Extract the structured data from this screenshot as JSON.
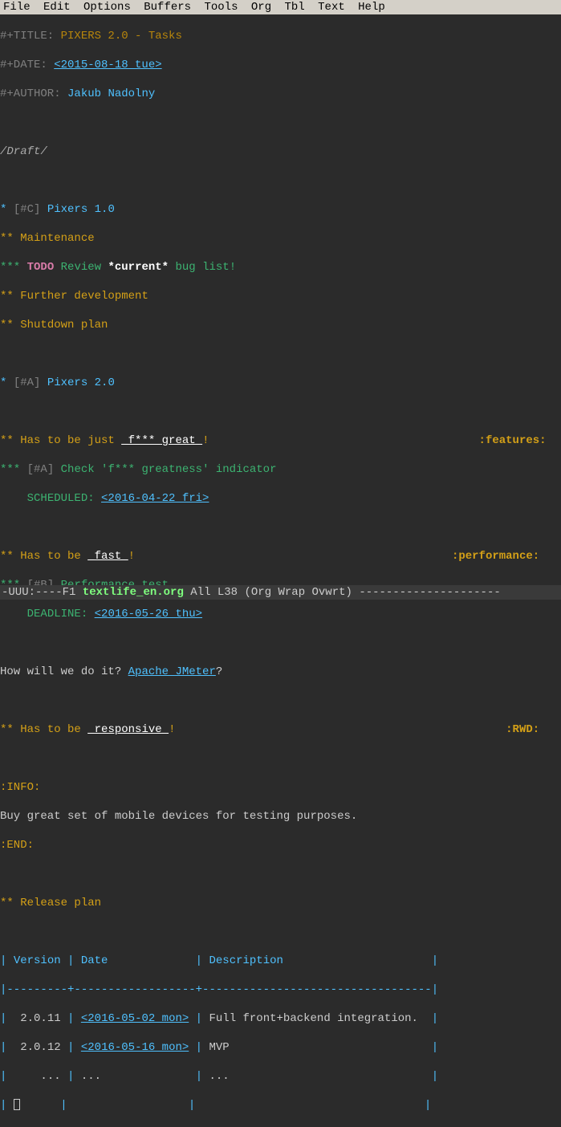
{
  "menubar": {
    "items": [
      "File",
      "Edit",
      "Options",
      "Buffers",
      "Tools",
      "Org",
      "Tbl",
      "Text",
      "Help"
    ]
  },
  "header": {
    "title_key": "#+TITLE:",
    "title_val": "PIXERS 2.0 - Tasks",
    "date_key": "#+DATE:",
    "date_val": "<2015-08-18 tue>",
    "author_key": "#+AUTHOR:",
    "author_val": "Jakub Nadolny"
  },
  "draft": "/Draft/",
  "h1a_star": "*",
  "h1a_pri": "[#C]",
  "h1a_txt": "Pixers 1.0",
  "h2_maint": "Maintenance",
  "h3_todo": "TODO",
  "h3_review": "Review",
  "h3_current": "*current*",
  "h3_buglist": "bug list!",
  "h2_further": "Further development",
  "h2_shutdown": "Shutdown plan",
  "h1b_pri": "[#A]",
  "h1b_txt": "Pixers 2.0",
  "great_pre": "Has to be just ",
  "great_u": "_f*** great_",
  "great_post": "!",
  "tag_features": ":features:",
  "check_pri": "[#A]",
  "check_txt": "Check 'f*** greatness' indicator",
  "scheduled": "SCHEDULED:",
  "scheduled_date": "<2016-04-22 fri>",
  "fast_pre": "Has to be ",
  "fast_u": "_fast_",
  "fast_post": "!",
  "tag_perf": ":performance:",
  "perf_pri": "[#B]",
  "perf_txt": "Performance test",
  "deadline": "DEADLINE:",
  "deadline_date": "<2016-05-26 thu>",
  "howwill_pre": "How will we do it? ",
  "howwill_link": "Apache JMeter",
  "howwill_post": "?",
  "resp_pre": "Has to be ",
  "resp_u": "_responsive_",
  "resp_post": "!",
  "tag_rwd": ":RWD:",
  "info_open": ":INFO:",
  "info_body": "Buy great set of mobile devices for testing purposes.",
  "info_end": ":END:",
  "release": "Release plan",
  "tbl": {
    "h1": "Version",
    "h2": "Date",
    "h3": "Description",
    "r1c1": "2.0.11",
    "r1c2": "<2016-05-02 mon>",
    "r1c3": "Full front+backend integration.",
    "r2c1": "2.0.12",
    "r2c2": "<2016-05-16 mon>",
    "r2c3": "MVP",
    "dots": "..."
  },
  "modeline": {
    "left": "-UUU:----F1",
    "fname": "textlife_en.org",
    "pos": "All L38",
    "mode": "(Org Wrap Ovwrt)",
    "tail": "---------------------"
  }
}
